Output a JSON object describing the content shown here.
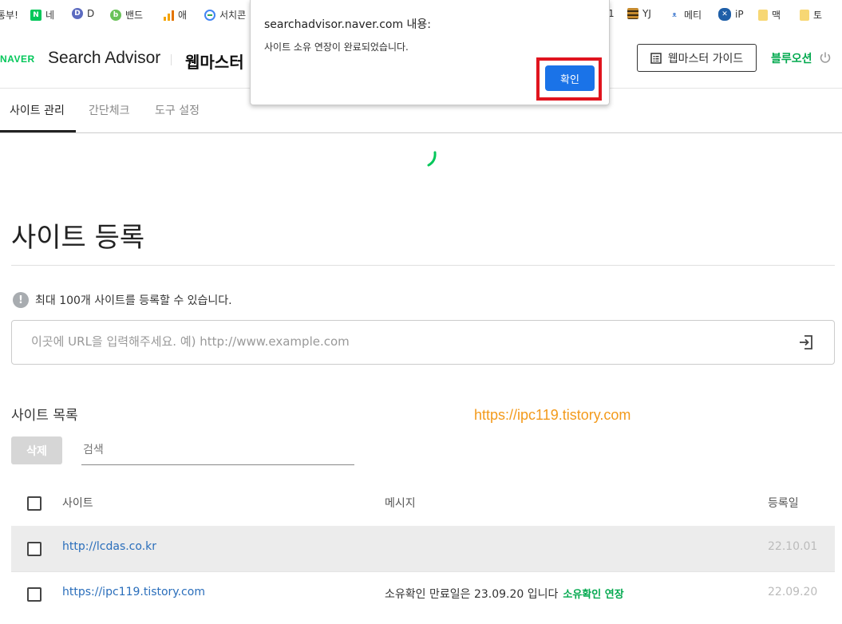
{
  "bookmarks": [
    {
      "label": "통부!",
      "icon": "bookmark-icon",
      "color": "#ffffff"
    },
    {
      "label": "네",
      "icon": "naver-n-icon",
      "color": "#03c75a"
    },
    {
      "label": "D",
      "icon": "daum-d-icon",
      "color": "#5c6bc0"
    },
    {
      "label": "밴드",
      "icon": "band-icon",
      "color": "#6ac259"
    },
    {
      "label": "애",
      "icon": "analytics-icon",
      "color": "#f4a300"
    },
    {
      "label": "서치콘",
      "icon": "search-console-icon",
      "color": "#4285f4"
    },
    {
      "label": "1",
      "icon": "bookmark-icon",
      "color": "#ffffff"
    },
    {
      "label": "YJ",
      "icon": "striped-folder-icon",
      "color": "#c58a2e"
    },
    {
      "label": "메티",
      "icon": "meta-icon",
      "color": "#5b8dd6"
    },
    {
      "label": "iP",
      "icon": "x-circle-icon",
      "color": "#1f5fa8"
    },
    {
      "label": "맥",
      "icon": "folder-icon",
      "color": "#f7d774"
    },
    {
      "label": "토",
      "icon": "folder-icon",
      "color": "#f7d774"
    }
  ],
  "header": {
    "logo": "NAVER",
    "app_name": "Search Advisor",
    "title": "웹마스터 도",
    "guide_button": "웹마스터 가이드",
    "user_name": "블루오션"
  },
  "tabs": [
    {
      "label": "사이트 관리",
      "active": true
    },
    {
      "label": "간단체크",
      "active": false
    },
    {
      "label": "도구 설정",
      "active": false
    }
  ],
  "main": {
    "title": "사이트 등록",
    "info_text": "최대 100개 사이트를 등록할 수 있습니다.",
    "url_placeholder": "이곳에 URL을 입력해주세요. 예) http://www.example.com",
    "list_title": "사이트 목록",
    "delete_button": "삭제",
    "search_placeholder": "검색",
    "watermark": "https://ipc119.tistory.com"
  },
  "table": {
    "headers": {
      "site": "사이트",
      "message": "메시지",
      "date": "등록일"
    },
    "rows": [
      {
        "site": "http://lcdas.co.kr",
        "message": "",
        "action": "",
        "date": "22.10.01"
      },
      {
        "site": "https://ipc119.tistory.com",
        "message": "소유확인 만료일은 23.09.20 입니다",
        "action": "소유확인 연장",
        "date": "22.09.20"
      }
    ]
  },
  "dialog": {
    "title": "searchadvisor.naver.com 내용:",
    "message": "사이트 소유 연장이 완료되었습니다.",
    "ok_button": "확인"
  },
  "colors": {
    "naver_green": "#03c75a",
    "dialog_button": "#1a73e8",
    "highlight": "#e0141e",
    "watermark": "#f39a1b"
  }
}
